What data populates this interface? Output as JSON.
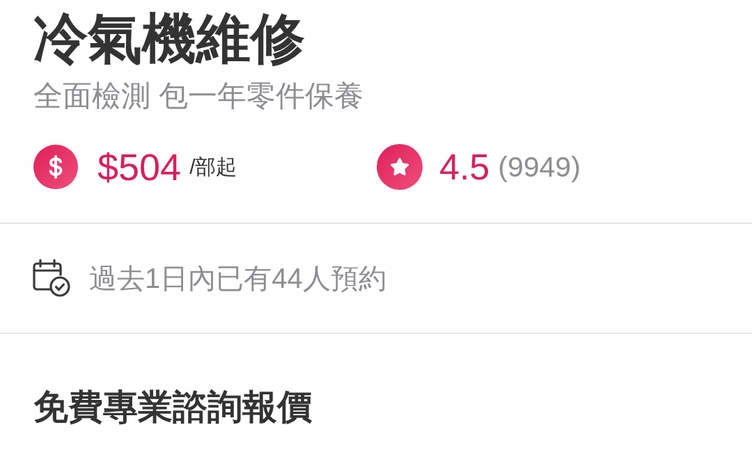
{
  "title": "冷氣機維修",
  "subtitle": "全面檢測 包一年零件保養",
  "price": {
    "amount": "$504",
    "unit": "/部起"
  },
  "rating": {
    "score": "4.5",
    "count": "(9949)"
  },
  "bookings": {
    "text": "過去1日內已有44人預約"
  },
  "section_title": "免費專業諮詢報價"
}
